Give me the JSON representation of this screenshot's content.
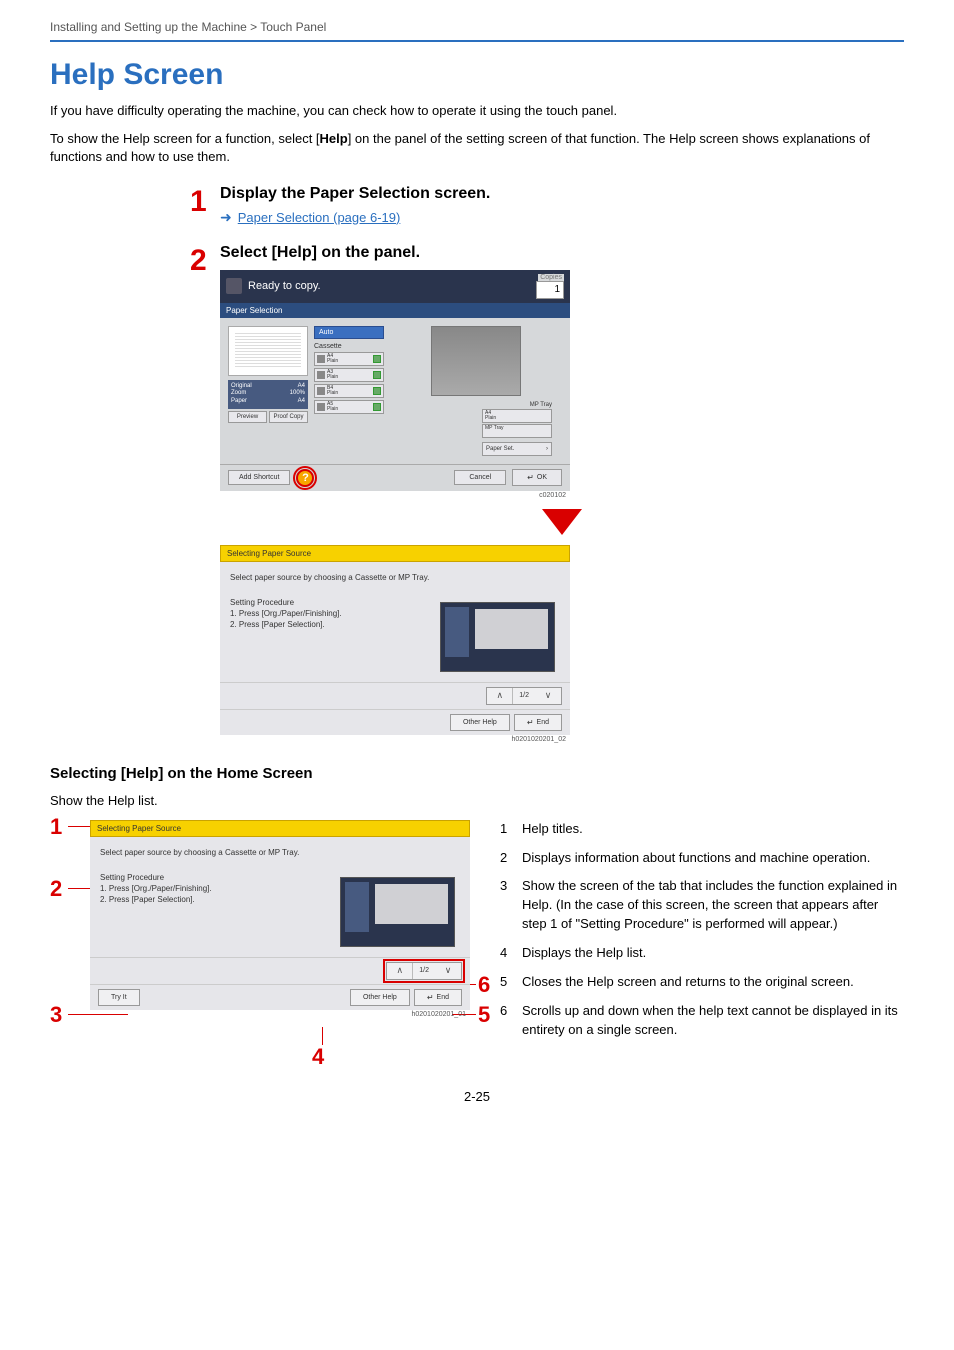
{
  "breadcrumb": "Installing and Setting up the Machine > Touch Panel",
  "title": "Help Screen",
  "intro1": "If you have difficulty operating the machine, you can check how to operate it using the touch panel.",
  "intro2_pre": "To show the Help screen for a function, select [",
  "intro2_bold": "Help",
  "intro2_post": "] on the panel of the setting screen of that function. The Help screen shows explanations of functions and how to use them.",
  "steps": {
    "s1": {
      "num": "1",
      "heading": "Display the Paper Selection screen.",
      "link": "Paper Selection (page 6-19)"
    },
    "s2": {
      "num": "2",
      "heading": "Select [Help] on the panel."
    }
  },
  "panel1": {
    "topbar_title": "Ready to copy.",
    "copies_label": "Copies",
    "copies_value": "1",
    "subbar": "Paper Selection",
    "info": {
      "original_label": "Original",
      "original_val": "A4",
      "zoom_label": "Zoom",
      "zoom_val": "100%",
      "paper_label": "Paper",
      "paper_val": "A4"
    },
    "preview": "Preview",
    "proof": "Proof Copy",
    "auto": "Auto",
    "cassette_label": "Cassette",
    "cassettes": [
      {
        "size": "A4",
        "type": "Plain"
      },
      {
        "size": "A3",
        "type": "Plain"
      },
      {
        "size": "B4",
        "type": "Plain"
      },
      {
        "size": "A5",
        "type": "Plain"
      }
    ],
    "mp_label": "MP Tray",
    "mp_rows": [
      {
        "size": "A4",
        "type": "Plain"
      },
      {
        "size": "MP Tray",
        "type": ""
      }
    ],
    "paper_set": "Paper Set.",
    "add_shortcut": "Add Shortcut",
    "cancel": "Cancel",
    "ok": "OK",
    "img_id": "c020102"
  },
  "panel2": {
    "ytitle": "Selecting Paper Source",
    "para1": "Select paper source by choosing a Cassette or MP Tray.",
    "proc_head": "Setting Procedure",
    "proc_1": "1. Press [Org./Paper/Finishing].",
    "proc_2": "2. Press [Paper Selection].",
    "page": "1/2",
    "other_help": "Other Help",
    "end": "End",
    "tryit": "Try It",
    "img_id_a": "h0201020201_02",
    "img_id_b": "h0201020201_01"
  },
  "subhead": "Selecting [Help] on the Home Screen",
  "subintro": "Show the Help list.",
  "callouts": {
    "c1": "1",
    "c2": "2",
    "c3": "3",
    "c4": "4",
    "c5": "5",
    "c6": "6"
  },
  "descs": {
    "d1": {
      "n": "1",
      "t": "Help titles."
    },
    "d2": {
      "n": "2",
      "t": "Displays information about functions and machine operation."
    },
    "d3": {
      "n": "3",
      "t": "Show the screen of the tab that includes the function explained in Help. (In the case of this screen, the screen that appears after step 1 of \"Setting Procedure\" is performed will appear.)"
    },
    "d4": {
      "n": "4",
      "t": "Displays the Help list."
    },
    "d5": {
      "n": "5",
      "t": "Closes the Help screen and returns to the original screen."
    },
    "d6": {
      "n": "6",
      "t": "Scrolls up and down when the help text cannot be displayed in its entirety on a single screen."
    }
  },
  "page_num": "2-25"
}
